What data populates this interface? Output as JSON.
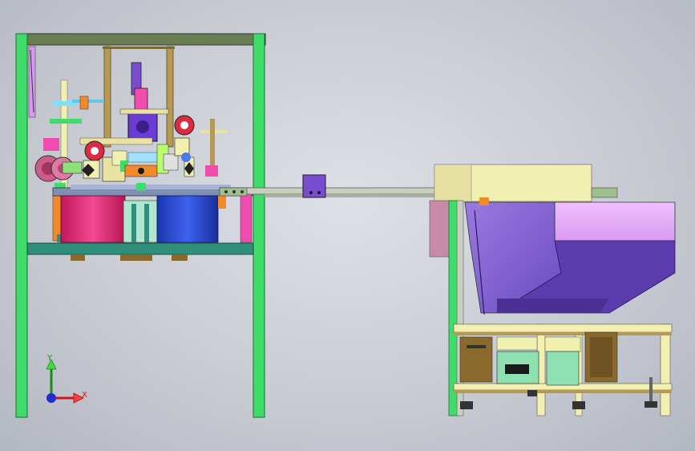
{
  "viewport": {
    "background_colors": [
      "#dde0e6",
      "#c9ccd3",
      "#b3b7c0"
    ]
  },
  "scene": {
    "description_hidden": false,
    "colors": {
      "frame_green": "#3fdc6c",
      "frame_top": "#6b7d52",
      "base_plate": "#2f8f7a",
      "drum_magenta": "#e8307a",
      "drum_blue": "#2f52d8",
      "hopper_purple": "#8c6bd6",
      "hopper_light": "#e0a8f0",
      "rail_gray": "#c8cfbf",
      "cover_yellow": "#f2f0b0",
      "motor_purple": "#7a4cd0",
      "wood_column": "#b59a55"
    }
  },
  "triad": {
    "y_label": "Y",
    "x_label": "X",
    "y_color": "#1a8a1a",
    "x_color": "#d01818",
    "z_color": "#1d2fd0"
  }
}
